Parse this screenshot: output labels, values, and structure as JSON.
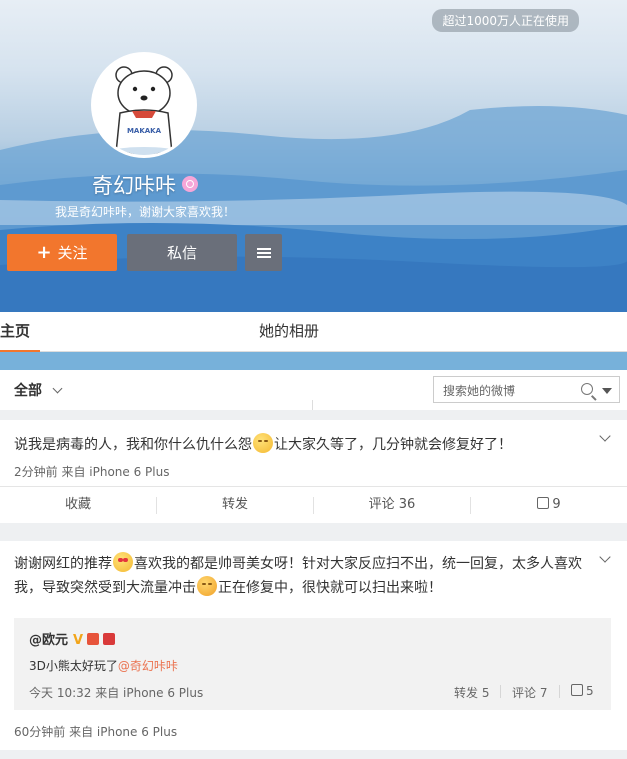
{
  "header": {
    "user_count_badge": "超过1000万人正在使用",
    "avatar_text": "MAKAKA",
    "name": "奇幻咔咔",
    "bio": "我是奇幻咔咔，谢谢大家喜欢我！",
    "follow_label": "关注",
    "message_label": "私信"
  },
  "tabs": {
    "home": "主页",
    "album": "她的相册"
  },
  "filter": {
    "all_label": "全部",
    "search_placeholder": "搜索她的微博"
  },
  "posts": [
    {
      "text_before": "说我是病毒的人，我和你什么仇什么怨",
      "text_after": "让大家久等了，几分钟就会修复好了！",
      "meta": "2分钟前 来自 iPhone 6 Plus",
      "actions": {
        "favorite": "收藏",
        "repost": "转发",
        "comment": "评论 36",
        "like": "9"
      }
    },
    {
      "text_part1": "谢谢网红的推荐",
      "text_part2": "喜欢我的都是帅哥美女呀！针对大家反应扫不出，统一回复，太多人喜欢我，导致突然受到大流量冲击",
      "text_part3": "正在修复中，很快就可以扫出来啦！",
      "repost": {
        "user": "@欧元",
        "text": "3D小熊太好玩了",
        "mention": "@奇幻咔咔",
        "meta": "今天 10:32 来自 iPhone 6 Plus",
        "repost_count": "转发 5",
        "comment_count": "评论 7",
        "like_count": "5"
      },
      "meta": "60分钟前 来自 iPhone 6 Plus"
    }
  ],
  "colors": {
    "accent": "#f2762d",
    "button_dark": "#6a6f7a",
    "strip": "#77b1da",
    "mention": "#eb7350"
  }
}
